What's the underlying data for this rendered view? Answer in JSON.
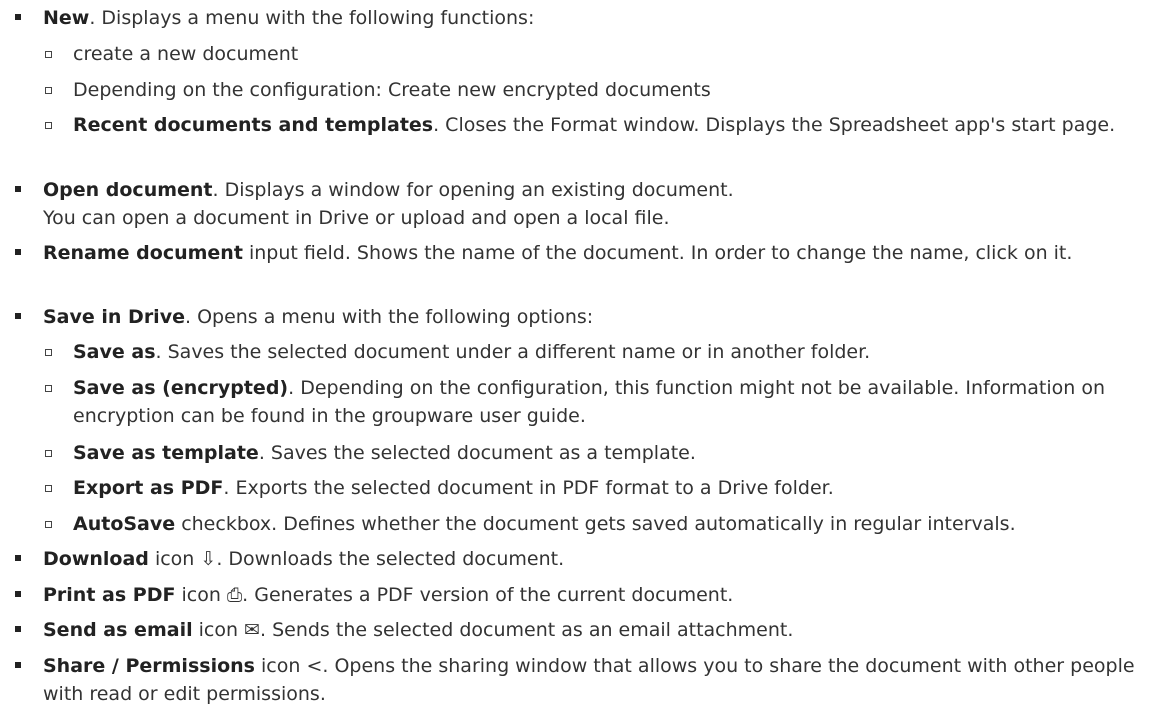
{
  "items": [
    {
      "level": 1,
      "bold": "New",
      "rest": ". Displays a menu with the following functions:"
    },
    {
      "level": 2,
      "bold": "",
      "rest": "create a new document"
    },
    {
      "level": 2,
      "bold": "",
      "rest": "Depending on the configuration: Create new encrypted documents"
    },
    {
      "level": 2,
      "bold": "Recent documents and templates",
      "rest": ". Closes the Format window. Displays the Spreadsheet app's start page."
    },
    {
      "level": 1,
      "bold": "Open document",
      "rest": ". Displays a window for opening an existing document.",
      "line2": "You can open a document in Drive or upload and open a local file."
    },
    {
      "level": 1,
      "bold": "Rename document",
      "rest": " input field. Shows the name of the document. In order to change the name, click on it."
    },
    {
      "level": 1,
      "bold": "Save in Drive",
      "rest": ". Opens a menu with the following options:"
    },
    {
      "level": 2,
      "bold": "Save as",
      "rest": ". Saves the selected document under a different name or in another folder."
    },
    {
      "level": 2,
      "bold": "Save as (encrypted)",
      "rest": ". Depending on the configuration, this function might not be available. Information on encryption can be found in the groupware user guide."
    },
    {
      "level": 2,
      "bold": "Save as template",
      "rest": ". Saves the selected document as a template."
    },
    {
      "level": 2,
      "bold": "Export as PDF",
      "rest": ". Exports the selected document in PDF format to a Drive folder."
    },
    {
      "level": 2,
      "bold": "AutoSave",
      "rest": " checkbox. Defines whether the document gets saved automatically in regular intervals."
    },
    {
      "level": 1,
      "bold": "Download",
      "rest_a": " icon ",
      "icon": "⇩",
      "icon_name": "download-icon",
      "rest": ". Downloads the selected document."
    },
    {
      "level": 1,
      "bold": "Print as PDF",
      "rest_a": " icon ",
      "icon": "⎙",
      "icon_name": "print-icon",
      "rest": ". Generates a PDF version of the current document."
    },
    {
      "level": 1,
      "bold": "Send as email",
      "rest_a": " icon ",
      "icon": "✉",
      "icon_name": "email-icon",
      "rest": ". Sends the selected document as an email attachment."
    },
    {
      "level": 1,
      "bold": "Share / Permissions",
      "rest_a": " icon ",
      "icon": "<",
      "icon_name": "share-icon",
      "rest": ". Opens the sharing window that allows you to share the document with other people with read or edit permissions."
    }
  ]
}
